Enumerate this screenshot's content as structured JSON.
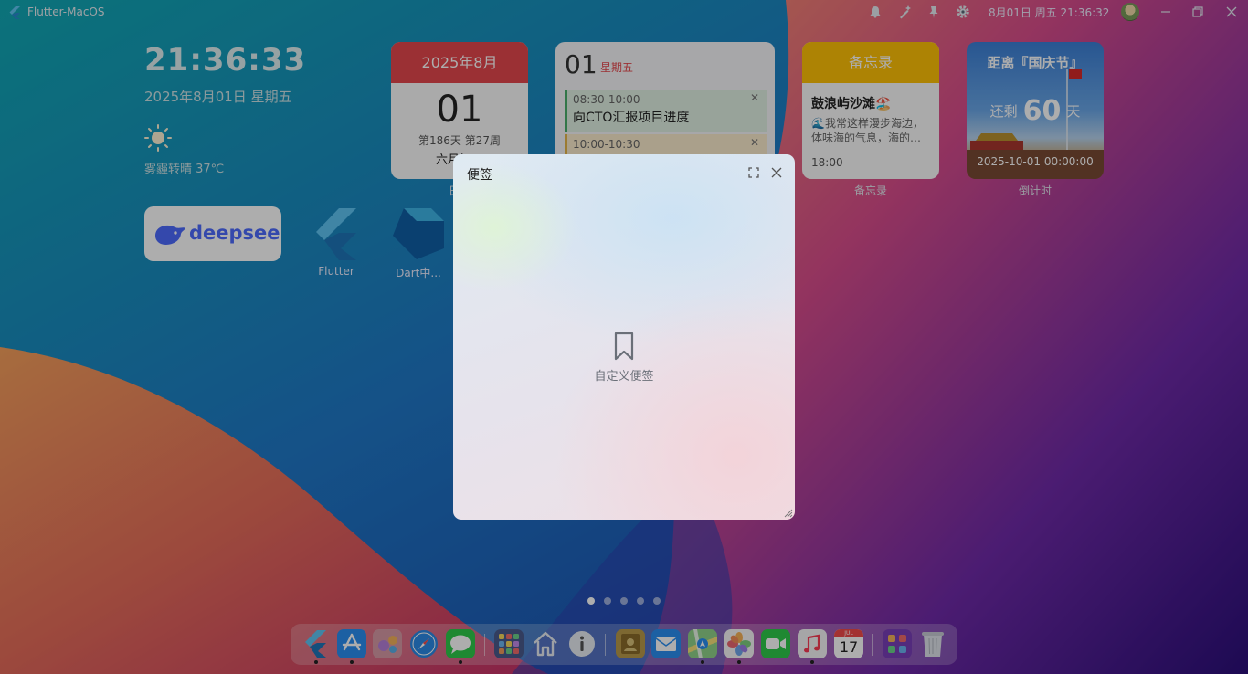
{
  "menubar": {
    "app_name": "Flutter-MacOS",
    "datetime": "8月01日 周五  21:36:32",
    "icons": [
      "bell-icon",
      "magic-wand-icon",
      "pin-icon",
      "gear-icon",
      "avatar",
      "minimize-icon",
      "restore-icon",
      "close-icon"
    ]
  },
  "clock": {
    "time": "21:36:33",
    "date": "2025年8月01日 星期五",
    "weather": "雾霾转晴 37℃",
    "weather_icon": "sun-icon"
  },
  "calendar": {
    "header": "2025年8月",
    "day": "01",
    "week_info": "第186天 第27周",
    "lunar": "六月初八",
    "label": "日历",
    "header_color": "#e5484d"
  },
  "schedule": {
    "day": "01",
    "weekday": "星期五",
    "items": [
      {
        "time": "08:30-10:00",
        "title": "向CTO汇报项目进度"
      },
      {
        "time": "10:00-10:30",
        "title": ""
      }
    ]
  },
  "memo": {
    "header": "备忘录",
    "title": "鼓浪屿沙滩🏖️",
    "body": "🌊我常这样漫步海边，体味海的气息，海的…",
    "time": "18:00",
    "label": "备忘录",
    "header_color": "#ffc107"
  },
  "countdown": {
    "title": "距离『国庆节』",
    "prefix": "还剩",
    "days": "60",
    "suffix": "天",
    "date": "2025-10-01 00:00:00",
    "label": "倒计时"
  },
  "apps": {
    "deepseek": "deepseek",
    "flutter": "Flutter",
    "dart": "Dart中..."
  },
  "pager": {
    "count": 5,
    "active": 0
  },
  "dock": {
    "items": [
      "flutter-icon",
      "app-store-icon",
      "game-center-icon",
      "safari-icon",
      "messages-icon",
      "launchpad-icon",
      "home-icon",
      "info-icon",
      "contacts-icon",
      "mail-icon",
      "maps-icon",
      "photos-icon",
      "facetime-icon",
      "music-icon",
      "calendar-icon",
      "apps-folder-icon",
      "trash-icon"
    ],
    "calendar_month": "JUL",
    "calendar_day": "17"
  },
  "modal": {
    "title": "便签",
    "empty_label": "自定义便签",
    "icons": [
      "fullscreen-icon",
      "close-icon",
      "bookmark-icon",
      "resize-grip-icon"
    ]
  }
}
